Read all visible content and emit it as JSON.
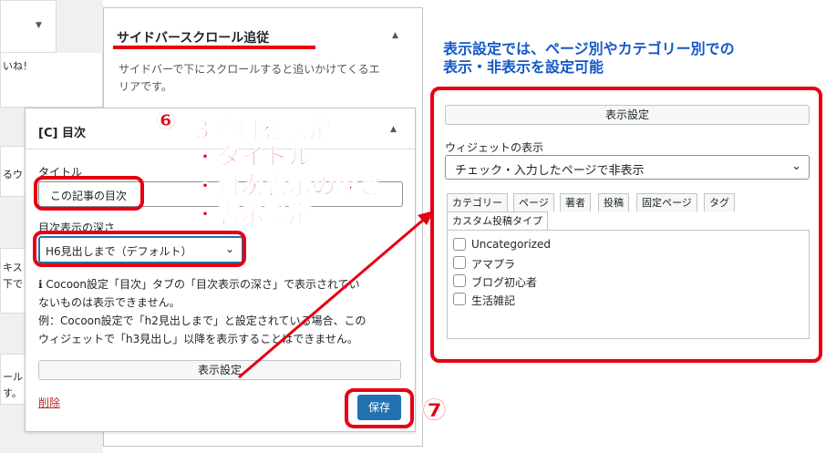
{
  "left_fragments": [
    "いね！",
    "るウ",
    "キス",
    "下で",
    "ール",
    "す。"
  ],
  "sidebar_widget": {
    "title": "サイドバースクロール追従",
    "description_line1": "サイドバーで下にスクロールすると追いかけてくるエ",
    "description_line2": "リアです。"
  },
  "toc_widget": {
    "title": "[C] 目次",
    "title_label": "タイトル",
    "title_value": "この記事の目次",
    "depth_label": "目次表示の深さ",
    "depth_value": "H6見出しまで（デフォルト）",
    "help_line1": "Cocoon設定「目次」タブの「目次表示の深さ」で表示されてい",
    "help_line2": "ないものは表示できません。",
    "help_line3": "例：Cocoon設定で「h2見出しまで」と設定されている場合、この",
    "help_line4": "ウィジェットで「h3見出し」以降を表示することはできません。",
    "display_button": "表示設定",
    "delete_link": "削除",
    "save_button": "保存"
  },
  "display_panel": {
    "button": "表示設定",
    "visibility_label": "ウィジェットの表示",
    "visibility_value": "チェック・入力したページで非表示",
    "tabs": [
      "カテゴリー",
      "ページ",
      "著者",
      "投稿",
      "固定ページ",
      "タグ",
      "カスタム投稿タイプ"
    ],
    "categories": [
      "Uncategorized",
      "アマプラ",
      "ブログ初心者",
      "生活雑記"
    ]
  },
  "annotations": {
    "step6_number": "⑥",
    "step6_title": "３項目を設定",
    "step6_item1": "・タイトル",
    "step6_item2": "・目次表示の深さ",
    "step6_item3": "・表示設定",
    "step7_number": "⑦",
    "display_note_line1": "表示設定では、ページ別やカテゴリー別での",
    "display_note_line2": "表示・非表示を設定可能"
  },
  "colors": {
    "highlight_red": "#e60012",
    "note_blue": "#1458c8",
    "primary_button": "#2271b1",
    "link_red": "#b32d2e"
  }
}
